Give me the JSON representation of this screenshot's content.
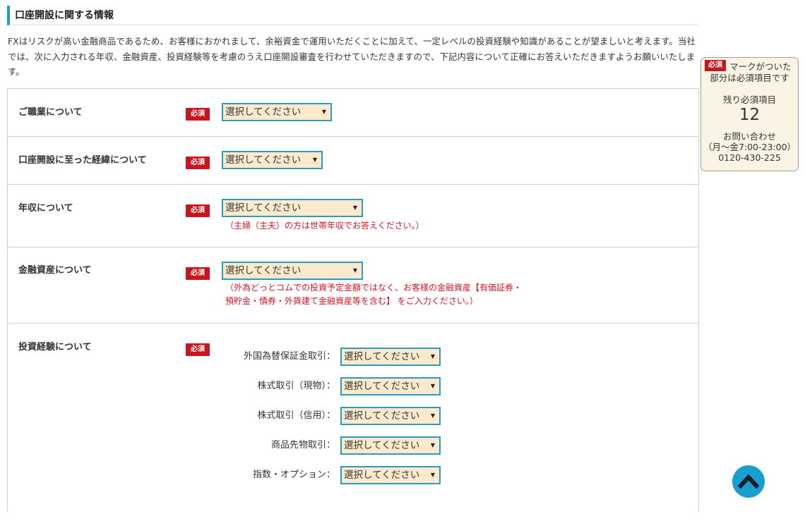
{
  "section": {
    "title": "口座開設に関する情報",
    "intro": "FXはリスクが高い金融商品であるため、お客様におかれまして、余裕資金で運用いただくことに加えて、一定レベルの投資経験や知識があることが望ましいと考えます。当社では、次に入力される年収、金融資産、投資経験等を考慮のうえ口座開設審査を行わせていただきますので、下記内容について正確にお答えいただきますようお願いいたします。"
  },
  "required_label": "必須",
  "select_placeholder": "選択してください",
  "rows": {
    "occupation": {
      "label": "ご職業について"
    },
    "reason": {
      "label": "口座開設に至った経緯について"
    },
    "income": {
      "label": "年収について",
      "note": "（主婦（主夫）の方は世帯年収でお答えください。）"
    },
    "assets": {
      "label": "金融資産について",
      "note_line1": "（外為どっとコムでの投資予定金額ではなく、お客様の金融資産【有価証券・",
      "note_line2": "預貯金・債券・外貨建て金融資産等を含む】 をご入力ください。）"
    },
    "experience": {
      "label": "投資経験について",
      "items": [
        {
          "label": "外国為替保証金取引："
        },
        {
          "label": "株式取引（現物）："
        },
        {
          "label": "株式取引（信用）："
        },
        {
          "label": "商品先物取引："
        },
        {
          "label": "指数・オプション："
        }
      ]
    }
  },
  "sidebar": {
    "required_tag": "必須",
    "mark_text": "マークがついた",
    "part_text": "部分は必須項目です",
    "remaining_label": "残り必須項目",
    "remaining_count": "12",
    "contact_title": "お問い合わせ",
    "contact_hours": "（月～金7:00-23:00）",
    "contact_phone": "0120-430-225"
  },
  "scroll_top_icon": "chevron-up-icon",
  "colors": {
    "accent": "#1b9fcf",
    "required_red": "#c9151e",
    "note_red": "#d0152b",
    "select_bg": "#fde9cc",
    "select_border": "#2a9bc4",
    "sidebar_bg": "#fbf3e3"
  }
}
